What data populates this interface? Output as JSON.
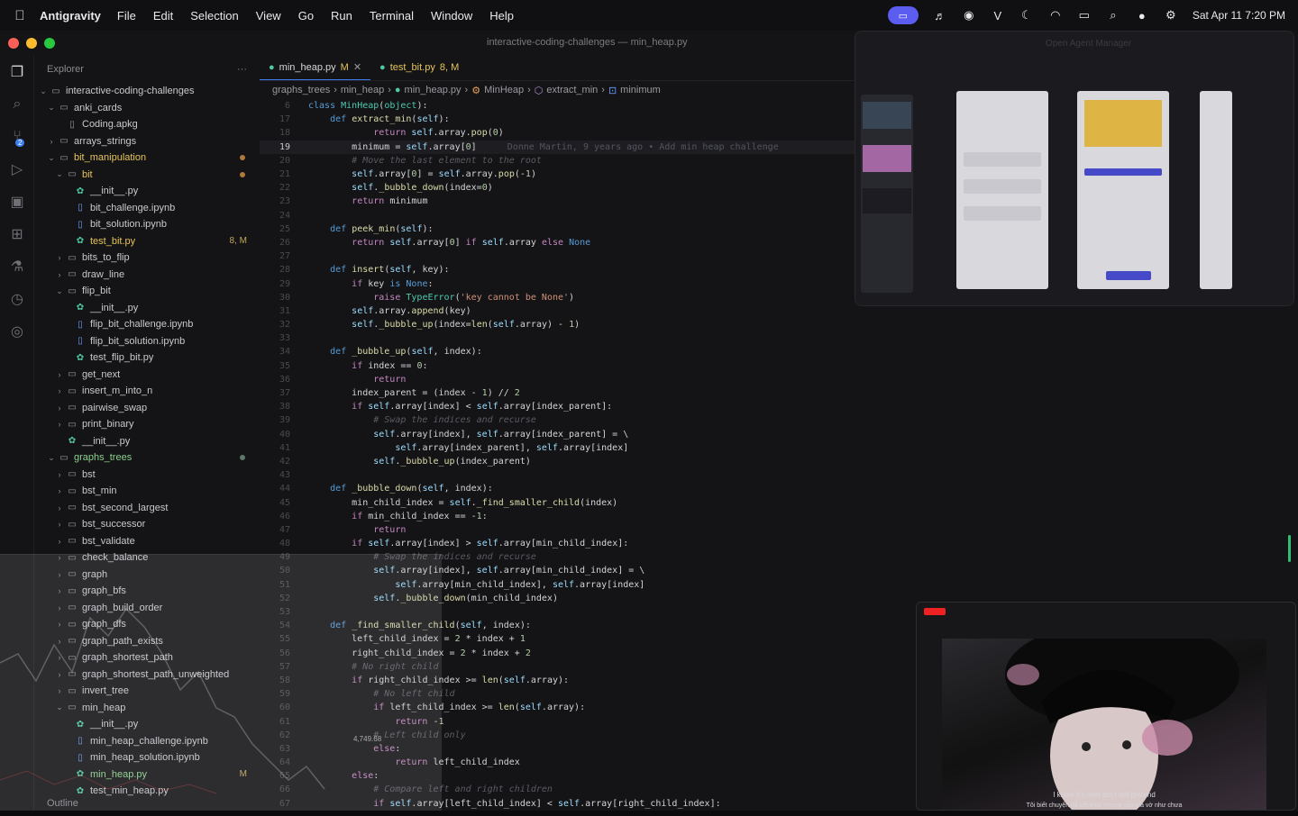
{
  "menubar": {
    "app_name": "Antigravity",
    "menus": [
      "File",
      "Edit",
      "Selection",
      "View",
      "Go",
      "Run",
      "Terminal",
      "Window",
      "Help"
    ],
    "datetime": "Sat Apr 11  7:20 PM"
  },
  "window": {
    "title": "interactive-coding-challenges — min_heap.py"
  },
  "activity_bar": {
    "scm_badge": "2"
  },
  "sidebar": {
    "header": "Explorer",
    "more": "···",
    "outline": "Outline",
    "tree": [
      {
        "label": "interactive-coding-challenges",
        "indent": 0,
        "type": "folder-open"
      },
      {
        "label": "anki_cards",
        "indent": 1,
        "type": "folder-open"
      },
      {
        "label": "Coding.apkg",
        "indent": 2,
        "type": "file"
      },
      {
        "label": "arrays_strings",
        "indent": 1,
        "type": "folder"
      },
      {
        "label": "bit_manipulation",
        "indent": 1,
        "type": "folder-open",
        "style": "mod",
        "dot": "orange"
      },
      {
        "label": "bit",
        "indent": 2,
        "type": "folder-open",
        "style": "mod",
        "dot": "orange"
      },
      {
        "label": "__init__.py",
        "indent": 3,
        "type": "py"
      },
      {
        "label": "bit_challenge.ipynb",
        "indent": 3,
        "type": "nb"
      },
      {
        "label": "bit_solution.ipynb",
        "indent": 3,
        "type": "nb"
      },
      {
        "label": "test_bit.py",
        "indent": 3,
        "type": "py",
        "style": "mod",
        "badge": "8, M"
      },
      {
        "label": "bits_to_flip",
        "indent": 2,
        "type": "folder"
      },
      {
        "label": "draw_line",
        "indent": 2,
        "type": "folder"
      },
      {
        "label": "flip_bit",
        "indent": 2,
        "type": "folder-open"
      },
      {
        "label": "__init__.py",
        "indent": 3,
        "type": "py"
      },
      {
        "label": "flip_bit_challenge.ipynb",
        "indent": 3,
        "type": "nb"
      },
      {
        "label": "flip_bit_solution.ipynb",
        "indent": 3,
        "type": "nb"
      },
      {
        "label": "test_flip_bit.py",
        "indent": 3,
        "type": "py"
      },
      {
        "label": "get_next",
        "indent": 2,
        "type": "folder"
      },
      {
        "label": "insert_m_into_n",
        "indent": 2,
        "type": "folder"
      },
      {
        "label": "pairwise_swap",
        "indent": 2,
        "type": "folder"
      },
      {
        "label": "print_binary",
        "indent": 2,
        "type": "folder"
      },
      {
        "label": "__init__.py",
        "indent": 2,
        "type": "py"
      },
      {
        "label": "graphs_trees",
        "indent": 1,
        "type": "folder-open",
        "style": "green",
        "dot": "grey"
      },
      {
        "label": "bst",
        "indent": 2,
        "type": "folder"
      },
      {
        "label": "bst_min",
        "indent": 2,
        "type": "folder"
      },
      {
        "label": "bst_second_largest",
        "indent": 2,
        "type": "folder"
      },
      {
        "label": "bst_successor",
        "indent": 2,
        "type": "folder"
      },
      {
        "label": "bst_validate",
        "indent": 2,
        "type": "folder"
      },
      {
        "label": "check_balance",
        "indent": 2,
        "type": "folder"
      },
      {
        "label": "graph",
        "indent": 2,
        "type": "folder"
      },
      {
        "label": "graph_bfs",
        "indent": 2,
        "type": "folder"
      },
      {
        "label": "graph_build_order",
        "indent": 2,
        "type": "folder"
      },
      {
        "label": "graph_dfs",
        "indent": 2,
        "type": "folder"
      },
      {
        "label": "graph_path_exists",
        "indent": 2,
        "type": "folder"
      },
      {
        "label": "graph_shortest_path",
        "indent": 2,
        "type": "folder"
      },
      {
        "label": "graph_shortest_path_unweighted",
        "indent": 2,
        "type": "folder"
      },
      {
        "label": "invert_tree",
        "indent": 2,
        "type": "folder"
      },
      {
        "label": "min_heap",
        "indent": 2,
        "type": "folder-open"
      },
      {
        "label": "__init__.py",
        "indent": 3,
        "type": "py"
      },
      {
        "label": "min_heap_challenge.ipynb",
        "indent": 3,
        "type": "nb"
      },
      {
        "label": "min_heap_solution.ipynb",
        "indent": 3,
        "type": "nb"
      },
      {
        "label": "min_heap.py",
        "indent": 3,
        "type": "py",
        "style": "green",
        "badge": "M"
      },
      {
        "label": "test_min_heap.py",
        "indent": 3,
        "type": "py"
      }
    ]
  },
  "editor": {
    "tabs": [
      {
        "label": "min_heap.py",
        "status": "M",
        "active": true
      },
      {
        "label": "test_bit.py",
        "status": "8, M",
        "active": false
      }
    ],
    "breadcrumb": [
      "graphs_trees",
      "min_heap",
      "min_heap.py",
      "MinHeap",
      "extract_min",
      "minimum"
    ],
    "blame": "Donne Martin, 9 years ago • Add min heap challenge",
    "lines": [
      {
        "n": "6",
        "html": "<span class='kw'>class</span> <span class='cl'>MinHeap</span>(<span class='cl'>object</span>):"
      },
      {
        "n": "17",
        "html": "    <span class='kw'>def</span> <span class='fn'>extract_min</span>(<span class='sf'>self</span>):"
      },
      {
        "n": "18",
        "html": "            <span class='bi'>return</span> <span class='sf'>self</span>.array.<span class='fn'>pop</span>(<span class='nm'>0</span>)"
      },
      {
        "n": "19",
        "html": "        minimum = <span class='sf'>self</span>.array[<span class='nm'>0</span>]",
        "cur": true
      },
      {
        "n": "20",
        "html": "        <span class='cm'># Move the last element to the root</span>"
      },
      {
        "n": "21",
        "html": "        <span class='sf'>self</span>.array[<span class='nm'>0</span>] = <span class='sf'>self</span>.array.<span class='fn'>pop</span>(-<span class='nm'>1</span>)"
      },
      {
        "n": "22",
        "html": "        <span class='sf'>self</span>.<span class='fn'>_bubble_down</span>(index=<span class='nm'>0</span>)"
      },
      {
        "n": "23",
        "html": "        <span class='bi'>return</span> minimum"
      },
      {
        "n": "24",
        "html": ""
      },
      {
        "n": "25",
        "html": "    <span class='kw'>def</span> <span class='fn'>peek_min</span>(<span class='sf'>self</span>):"
      },
      {
        "n": "26",
        "html": "        <span class='bi'>return</span> <span class='sf'>self</span>.array[<span class='nm'>0</span>] <span class='bi'>if</span> <span class='sf'>self</span>.array <span class='bi'>else</span> <span class='kw'>None</span>"
      },
      {
        "n": "27",
        "html": ""
      },
      {
        "n": "28",
        "html": "    <span class='kw'>def</span> <span class='fn'>insert</span>(<span class='sf'>self</span>, key):"
      },
      {
        "n": "29",
        "html": "        <span class='bi'>if</span> key <span class='kw'>is</span> <span class='kw'>None</span>:"
      },
      {
        "n": "30",
        "html": "            <span class='bi'>raise</span> <span class='cl'>TypeError</span>(<span class='st'>'key cannot be None'</span>)"
      },
      {
        "n": "31",
        "html": "        <span class='sf'>self</span>.array.<span class='fn'>append</span>(key)"
      },
      {
        "n": "32",
        "html": "        <span class='sf'>self</span>.<span class='fn'>_bubble_up</span>(index=<span class='fn'>len</span>(<span class='sf'>self</span>.array) - <span class='nm'>1</span>)"
      },
      {
        "n": "33",
        "html": ""
      },
      {
        "n": "34",
        "html": "    <span class='kw'>def</span> <span class='fn'>_bubble_up</span>(<span class='sf'>self</span>, index):"
      },
      {
        "n": "35",
        "html": "        <span class='bi'>if</span> index == <span class='nm'>0</span>:"
      },
      {
        "n": "36",
        "html": "            <span class='bi'>return</span>"
      },
      {
        "n": "37",
        "html": "        index_parent = (index - <span class='nm'>1</span>) // <span class='nm'>2</span>"
      },
      {
        "n": "38",
        "html": "        <span class='bi'>if</span> <span class='sf'>self</span>.array[index] &lt; <span class='sf'>self</span>.array[index_parent]:"
      },
      {
        "n": "39",
        "html": "            <span class='cm'># Swap the indices and recurse</span>"
      },
      {
        "n": "40",
        "html": "            <span class='sf'>self</span>.array[index], <span class='sf'>self</span>.array[index_parent] = \\"
      },
      {
        "n": "41",
        "html": "                <span class='sf'>self</span>.array[index_parent], <span class='sf'>self</span>.array[index]"
      },
      {
        "n": "42",
        "html": "            <span class='sf'>self</span>.<span class='fn'>_bubble_up</span>(index_parent)"
      },
      {
        "n": "43",
        "html": ""
      },
      {
        "n": "44",
        "html": "    <span class='kw'>def</span> <span class='fn'>_bubble_down</span>(<span class='sf'>self</span>, index):"
      },
      {
        "n": "45",
        "html": "        min_child_index = <span class='sf'>self</span>.<span class='fn'>_find_smaller_child</span>(index)"
      },
      {
        "n": "46",
        "html": "        <span class='bi'>if</span> min_child_index == -<span class='nm'>1</span>:"
      },
      {
        "n": "47",
        "html": "            <span class='bi'>return</span>"
      },
      {
        "n": "48",
        "html": "        <span class='bi'>if</span> <span class='sf'>self</span>.array[index] &gt; <span class='sf'>self</span>.array[min_child_index]:"
      },
      {
        "n": "49",
        "html": "            <span class='cm'># Swap the indices and recurse</span>"
      },
      {
        "n": "50",
        "html": "            <span class='sf'>self</span>.array[index], <span class='sf'>self</span>.array[min_child_index] = \\"
      },
      {
        "n": "51",
        "html": "                <span class='sf'>self</span>.array[min_child_index], <span class='sf'>self</span>.array[index]"
      },
      {
        "n": "52",
        "html": "            <span class='sf'>self</span>.<span class='fn'>_bubble_down</span>(min_child_index)"
      },
      {
        "n": "53",
        "html": ""
      },
      {
        "n": "54",
        "html": "    <span class='kw'>def</span> <span class='fn'>_find_smaller_child</span>(<span class='sf'>self</span>, index):"
      },
      {
        "n": "55",
        "html": "        left_child_index = <span class='nm'>2</span> * index + <span class='nm'>1</span>"
      },
      {
        "n": "56",
        "html": "        right_child_index = <span class='nm'>2</span> * index + <span class='nm'>2</span>"
      },
      {
        "n": "57",
        "html": "        <span class='cm'># No right child</span>"
      },
      {
        "n": "58",
        "html": "        <span class='bi'>if</span> right_child_index &gt;= <span class='fn'>len</span>(<span class='sf'>self</span>.array):"
      },
      {
        "n": "59",
        "html": "            <span class='cm'># No left child</span>"
      },
      {
        "n": "60",
        "html": "            <span class='bi'>if</span> left_child_index &gt;= <span class='fn'>len</span>(<span class='sf'>self</span>.array):"
      },
      {
        "n": "61",
        "html": "                <span class='bi'>return</span> -<span class='nm'>1</span>"
      },
      {
        "n": "62",
        "html": "            <span class='cm'># Left child only</span>"
      },
      {
        "n": "63",
        "html": "            <span class='bi'>else</span>:"
      },
      {
        "n": "64",
        "html": "                <span class='bi'>return</span> left_child_index"
      },
      {
        "n": "65",
        "html": "        <span class='bi'>else</span>:"
      },
      {
        "n": "66",
        "html": "            <span class='cm'># Compare left and right children</span>"
      },
      {
        "n": "67",
        "html": "            <span class='bi'>if</span> <span class='sf'>self</span>.array[left_child_index] &lt; <span class='sf'>self</span>.array[right_child_index]:"
      }
    ]
  },
  "agent_panel": {
    "title": "Open Agent Manager"
  },
  "chart_overlay": {
    "value_label": "4,749.68"
  },
  "video": {
    "caption_top": "I know it's over but I still pretend",
    "caption_bottom": "Tôi biết chuyện đã kết thúc nhưng vẫn giả vờ như chưa"
  }
}
